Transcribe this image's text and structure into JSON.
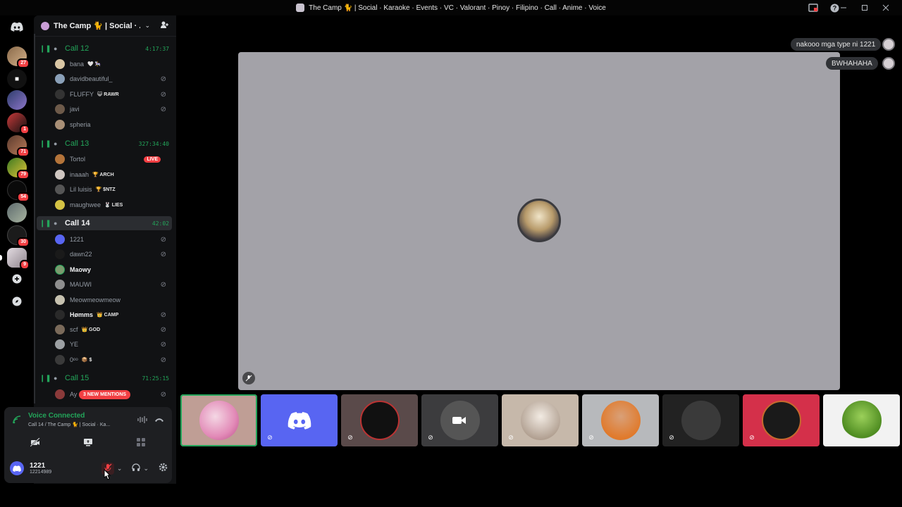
{
  "window": {
    "title": "The Camp 🐈 | Social · Karaoke · Events · VC · Valorant · Pinoy · Filipino · Call · Anime · Voice"
  },
  "rail": {
    "badges": [
      "27",
      "1",
      "71",
      "79",
      "54",
      "30",
      "9"
    ]
  },
  "server": {
    "name": "The Camp 🐈 | Social · ..."
  },
  "channels": [
    {
      "name": "Call 12",
      "timer": "4:17:37",
      "users": [
        {
          "name": "bana",
          "tag": "🤍 🎠"
        },
        {
          "name": "davidbeautiful_",
          "tag": ""
        },
        {
          "name": "FLUFFY",
          "tag": "😺 RAWR"
        },
        {
          "name": "javi",
          "tag": ""
        },
        {
          "name": "spheria",
          "tag": ""
        }
      ]
    },
    {
      "name": "Call 13",
      "timer": "327:34:40",
      "users": [
        {
          "name": "Tortol",
          "tag": "",
          "live": "LIVE"
        },
        {
          "name": "inaaah",
          "tag": "🏆 ARCH"
        },
        {
          "name": "Lil luisis",
          "tag": "🏆 $NTZ"
        },
        {
          "name": "maughwee",
          "tag": "🐰 LIES"
        }
      ]
    },
    {
      "name": "Call 14",
      "timer": "42:02",
      "users": [
        {
          "name": "1221",
          "tag": ""
        },
        {
          "name": "dawn22",
          "tag": ""
        },
        {
          "name": "Maowy",
          "tag": ""
        },
        {
          "name": "MAUWI",
          "tag": ""
        },
        {
          "name": "Meowmeowmeow",
          "tag": ""
        },
        {
          "name": "Hømms",
          "tag": "👑 CAMP"
        },
        {
          "name": "scf",
          "tag": "👑 GOD"
        },
        {
          "name": "YE",
          "tag": ""
        },
        {
          "name": "0ᵒᵒ",
          "tag": "📦 $"
        }
      ]
    },
    {
      "name": "Call 15",
      "timer": "71:25:15",
      "users": [
        {
          "name": "Ay",
          "tag": ""
        }
      ]
    }
  ],
  "mentions_pill": "3 NEW MENTIONS",
  "voice": {
    "status": "Voice Connected",
    "location": "Call 14 / The Camp 🐈 | Social · Ka..."
  },
  "me": {
    "name": "1221",
    "tag": "12214989"
  },
  "chat": [
    "nakooo mga type ni 1221",
    "BWHAHAHA"
  ],
  "colors": {
    "accent_green": "#23a55a",
    "danger_red": "#f23f43",
    "blurple": "#5865f2",
    "stage_bg": "#a3a2a8"
  }
}
